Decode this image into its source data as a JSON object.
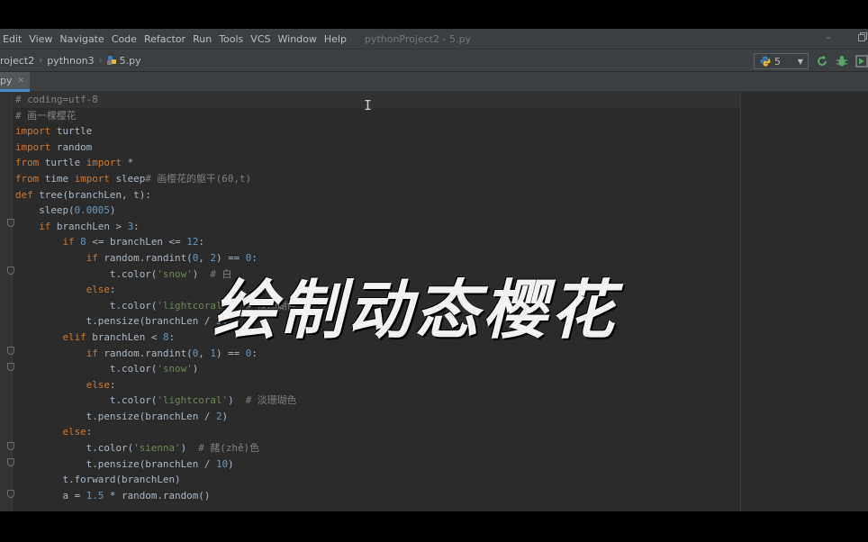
{
  "menubar": {
    "items": [
      "Edit",
      "View",
      "Navigate",
      "Code",
      "Refactor",
      "Run",
      "Tools",
      "VCS",
      "Window",
      "Help"
    ],
    "window_title": "pythonProject2 - 5.py"
  },
  "navbar": {
    "breadcrumbs": [
      "roject2",
      "pythnon3",
      "5.py"
    ],
    "run_config": "5"
  },
  "tabs": [
    {
      "label": "py",
      "close": "✕"
    }
  ],
  "editor": {
    "lines": [
      [
        {
          "t": "# coding=utf-8",
          "c": "cm"
        }
      ],
      [
        {
          "t": "# 画一棵樱花",
          "c": "cm"
        }
      ],
      [
        {
          "t": "import",
          "c": "kw"
        },
        {
          "t": " turtle",
          "c": "fn"
        }
      ],
      [
        {
          "t": "import",
          "c": "kw"
        },
        {
          "t": " random",
          "c": "fn"
        }
      ],
      [
        {
          "t": "from",
          "c": "kw"
        },
        {
          "t": " turtle ",
          "c": "fn"
        },
        {
          "t": "import",
          "c": "kw"
        },
        {
          "t": " *",
          "c": "fn"
        }
      ],
      [
        {
          "t": "from",
          "c": "kw"
        },
        {
          "t": " time ",
          "c": "fn"
        },
        {
          "t": "import",
          "c": "kw"
        },
        {
          "t": " sleep",
          "c": "fn"
        },
        {
          "t": "# 画樱花的躯干(60,t)",
          "c": "cm"
        }
      ],
      [
        {
          "t": "def",
          "c": "kw"
        },
        {
          "t": " tree(branchLen, t):",
          "c": "fn"
        }
      ],
      [
        {
          "t": "    sleep(",
          "c": "fn"
        },
        {
          "t": "0.0005",
          "c": "num"
        },
        {
          "t": ")",
          "c": "fn"
        }
      ],
      [
        {
          "t": "    ",
          "c": "fn"
        },
        {
          "t": "if",
          "c": "kw"
        },
        {
          "t": " branchLen > ",
          "c": "fn"
        },
        {
          "t": "3",
          "c": "num"
        },
        {
          "t": ":",
          "c": "fn"
        }
      ],
      [
        {
          "t": "        ",
          "c": "fn"
        },
        {
          "t": "if",
          "c": "kw"
        },
        {
          "t": " ",
          "c": "fn"
        },
        {
          "t": "8",
          "c": "num"
        },
        {
          "t": " <= branchLen <= ",
          "c": "fn"
        },
        {
          "t": "12",
          "c": "num"
        },
        {
          "t": ":",
          "c": "fn"
        }
      ],
      [
        {
          "t": "            ",
          "c": "fn"
        },
        {
          "t": "if",
          "c": "kw"
        },
        {
          "t": " random.randint(",
          "c": "fn"
        },
        {
          "t": "0",
          "c": "num"
        },
        {
          "t": ", ",
          "c": "fn"
        },
        {
          "t": "2",
          "c": "num"
        },
        {
          "t": ") == ",
          "c": "fn"
        },
        {
          "t": "0",
          "c": "num"
        },
        {
          "t": ":",
          "c": "fn"
        }
      ],
      [
        {
          "t": "                t.color(",
          "c": "fn"
        },
        {
          "t": "'snow'",
          "c": "str"
        },
        {
          "t": ")  ",
          "c": "fn"
        },
        {
          "t": "# 白",
          "c": "cm"
        }
      ],
      [
        {
          "t": "            ",
          "c": "fn"
        },
        {
          "t": "else",
          "c": "kw"
        },
        {
          "t": ":",
          "c": "fn"
        }
      ],
      [
        {
          "t": "                t.color(",
          "c": "fn"
        },
        {
          "t": "'lightcoral'",
          "c": "str"
        },
        {
          "t": ")  ",
          "c": "fn"
        },
        {
          "t": "# 淡珊瑚色",
          "c": "cm"
        }
      ],
      [
        {
          "t": "            t.pensize(branchLen / ",
          "c": "fn"
        },
        {
          "t": "3",
          "c": "num"
        },
        {
          "t": ")",
          "c": "fn"
        }
      ],
      [
        {
          "t": "        ",
          "c": "fn"
        },
        {
          "t": "elif",
          "c": "kw"
        },
        {
          "t": " branchLen < ",
          "c": "fn"
        },
        {
          "t": "8",
          "c": "num"
        },
        {
          "t": ":",
          "c": "fn"
        }
      ],
      [
        {
          "t": "            ",
          "c": "fn"
        },
        {
          "t": "if",
          "c": "kw"
        },
        {
          "t": " random.randint(",
          "c": "fn"
        },
        {
          "t": "0",
          "c": "num"
        },
        {
          "t": ", ",
          "c": "fn"
        },
        {
          "t": "1",
          "c": "num"
        },
        {
          "t": ") == ",
          "c": "fn"
        },
        {
          "t": "0",
          "c": "num"
        },
        {
          "t": ":",
          "c": "fn"
        }
      ],
      [
        {
          "t": "                t.color(",
          "c": "fn"
        },
        {
          "t": "'snow'",
          "c": "str"
        },
        {
          "t": ")",
          "c": "fn"
        }
      ],
      [
        {
          "t": "            ",
          "c": "fn"
        },
        {
          "t": "else",
          "c": "kw"
        },
        {
          "t": ":",
          "c": "fn"
        }
      ],
      [
        {
          "t": "                t.color(",
          "c": "fn"
        },
        {
          "t": "'lightcoral'",
          "c": "str"
        },
        {
          "t": ")  ",
          "c": "fn"
        },
        {
          "t": "# 淡珊瑚色",
          "c": "cm"
        }
      ],
      [
        {
          "t": "            t.pensize(branchLen / ",
          "c": "fn"
        },
        {
          "t": "2",
          "c": "num"
        },
        {
          "t": ")",
          "c": "fn"
        }
      ],
      [
        {
          "t": "        ",
          "c": "fn"
        },
        {
          "t": "else",
          "c": "kw"
        },
        {
          "t": ":",
          "c": "fn"
        }
      ],
      [
        {
          "t": "            t.color(",
          "c": "fn"
        },
        {
          "t": "'sienna'",
          "c": "str"
        },
        {
          "t": ")  ",
          "c": "fn"
        },
        {
          "t": "# 赭(zhě)色",
          "c": "cm"
        }
      ],
      [
        {
          "t": "            t.pensize(branchLen / ",
          "c": "fn"
        },
        {
          "t": "10",
          "c": "num"
        },
        {
          "t": ")",
          "c": "fn"
        }
      ],
      [
        {
          "t": "        t.forward(branchLen)",
          "c": "fn"
        }
      ],
      [
        {
          "t": "        a = ",
          "c": "fn"
        },
        {
          "t": "1.5",
          "c": "num"
        },
        {
          "t": " * random.random()",
          "c": "fn"
        }
      ]
    ]
  },
  "overlay": {
    "title": "绘制动态樱花"
  },
  "colors": {
    "keyword": "#cc7832",
    "comment": "#808080",
    "number": "#6897bb",
    "string": "#6a8759",
    "text": "#a9b7c6",
    "background": "#2b2b2b"
  }
}
